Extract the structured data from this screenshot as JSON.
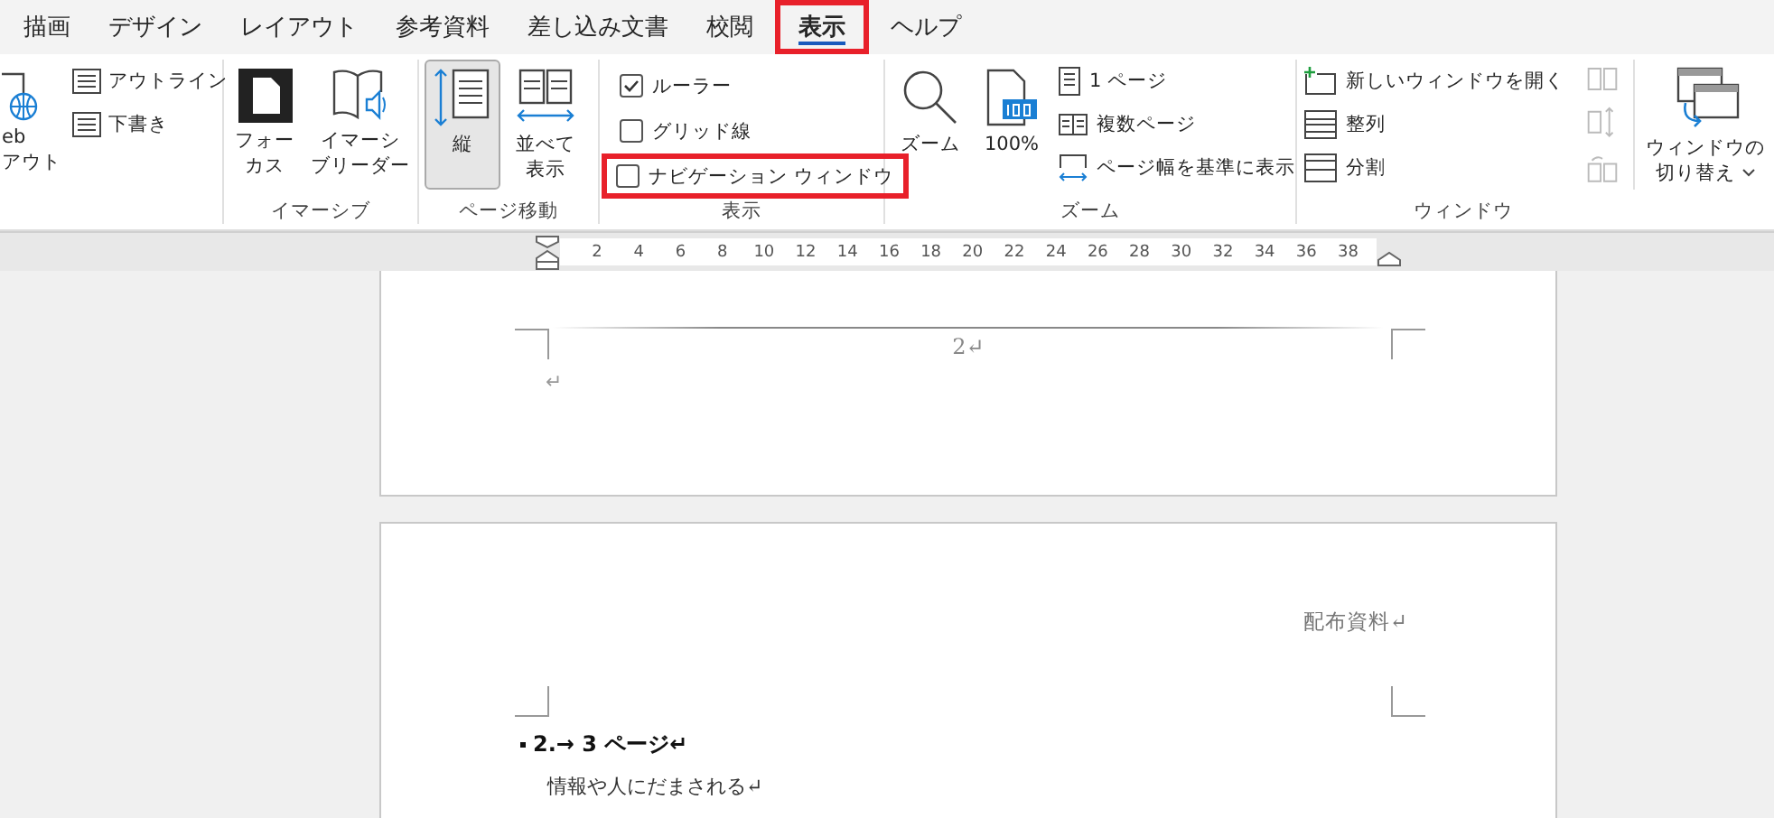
{
  "tabs": [
    {
      "label": "描画",
      "selected": false,
      "highlighted": false
    },
    {
      "label": "デザイン",
      "selected": false,
      "highlighted": false
    },
    {
      "label": "レイアウト",
      "selected": false,
      "highlighted": false
    },
    {
      "label": "参考資料",
      "selected": false,
      "highlighted": false
    },
    {
      "label": "差し込み文書",
      "selected": false,
      "highlighted": false
    },
    {
      "label": "校閲",
      "selected": false,
      "highlighted": false
    },
    {
      "label": "表示",
      "selected": true,
      "highlighted": true
    },
    {
      "label": "ヘルプ",
      "selected": false,
      "highlighted": false
    }
  ],
  "views_group": {
    "big_button": [
      "eb",
      "アウト"
    ],
    "items": [
      "アウトライン",
      "下書き"
    ]
  },
  "immersive_group": {
    "label": "イマーシブ",
    "buttons": [
      [
        "フォー",
        "カス"
      ],
      [
        "イマーシ",
        "ブリーダー"
      ]
    ]
  },
  "page_movement_group": {
    "label": "ページ移動",
    "buttons": [
      {
        "lines": [
          "縦"
        ],
        "selected": true
      },
      {
        "lines": [
          "並べて",
          "表示"
        ],
        "selected": false
      }
    ]
  },
  "show_group": {
    "label": "表示",
    "checkboxes": [
      {
        "label": "ルーラー",
        "checked": true,
        "highlighted": false
      },
      {
        "label": "グリッド線",
        "checked": false,
        "highlighted": false
      },
      {
        "label": "ナビゲーション ウィンドウ",
        "checked": false,
        "highlighted": true
      }
    ]
  },
  "zoom_group": {
    "label": "ズーム",
    "buttons": [
      "ズーム",
      "100%"
    ],
    "items": [
      "1 ページ",
      "複数ページ",
      "ページ幅を基準に表示"
    ]
  },
  "window_group": {
    "label": "ウィンドウ",
    "items": [
      "新しいウィンドウを開く",
      "整列",
      "分割"
    ],
    "switch_button": [
      "ウィンドウの",
      "切り替え"
    ]
  },
  "ruler": {
    "ticks": [
      "2",
      "4",
      "6",
      "8",
      "10",
      "12",
      "14",
      "16",
      "18",
      "20",
      "22",
      "24",
      "26",
      "28",
      "30",
      "32",
      "34",
      "36",
      "38"
    ]
  },
  "document": {
    "page_1": {
      "footer": "2↵",
      "end_mark": "↵"
    },
    "page_2": {
      "header": "配布資料↵",
      "heading": "2.→ 3 ページ↵",
      "body": "情報や人にだまされる↵"
    }
  }
}
